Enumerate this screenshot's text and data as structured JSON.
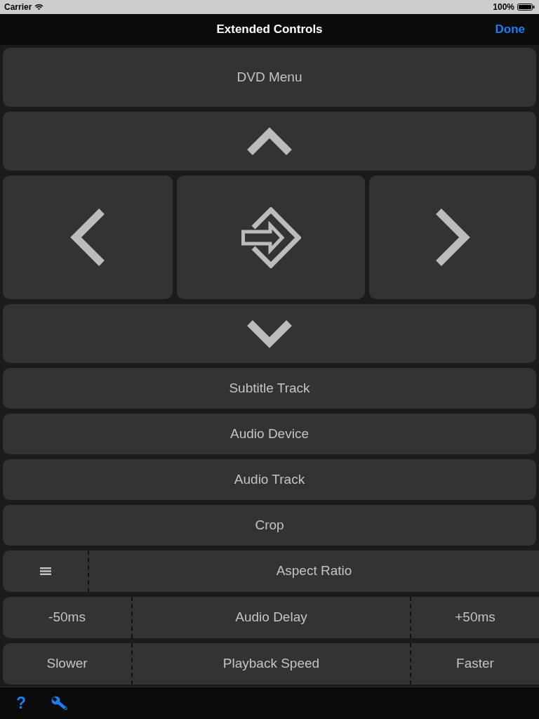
{
  "status_bar": {
    "carrier": "Carrier",
    "battery": "100%"
  },
  "nav_bar": {
    "title": "Extended Controls",
    "done": "Done"
  },
  "rows": [
    {
      "kind": "large",
      "label": "DVD Menu"
    },
    {
      "kind": "dpad"
    },
    {
      "kind": "button",
      "label": "Subtitle Track"
    },
    {
      "kind": "button",
      "label": "Audio Device"
    },
    {
      "kind": "button",
      "label": "Audio Track"
    },
    {
      "kind": "button",
      "label": "Crop"
    },
    {
      "kind": "menu_split",
      "label": "Aspect Ratio"
    },
    {
      "kind": "stepper",
      "decrease": "-50ms",
      "label": "Audio Delay",
      "increase": "+50ms"
    },
    {
      "kind": "stepper",
      "decrease": "Slower",
      "label": "Playback Speed",
      "increase": "Faster"
    }
  ],
  "toolbar": {
    "help": "?"
  }
}
